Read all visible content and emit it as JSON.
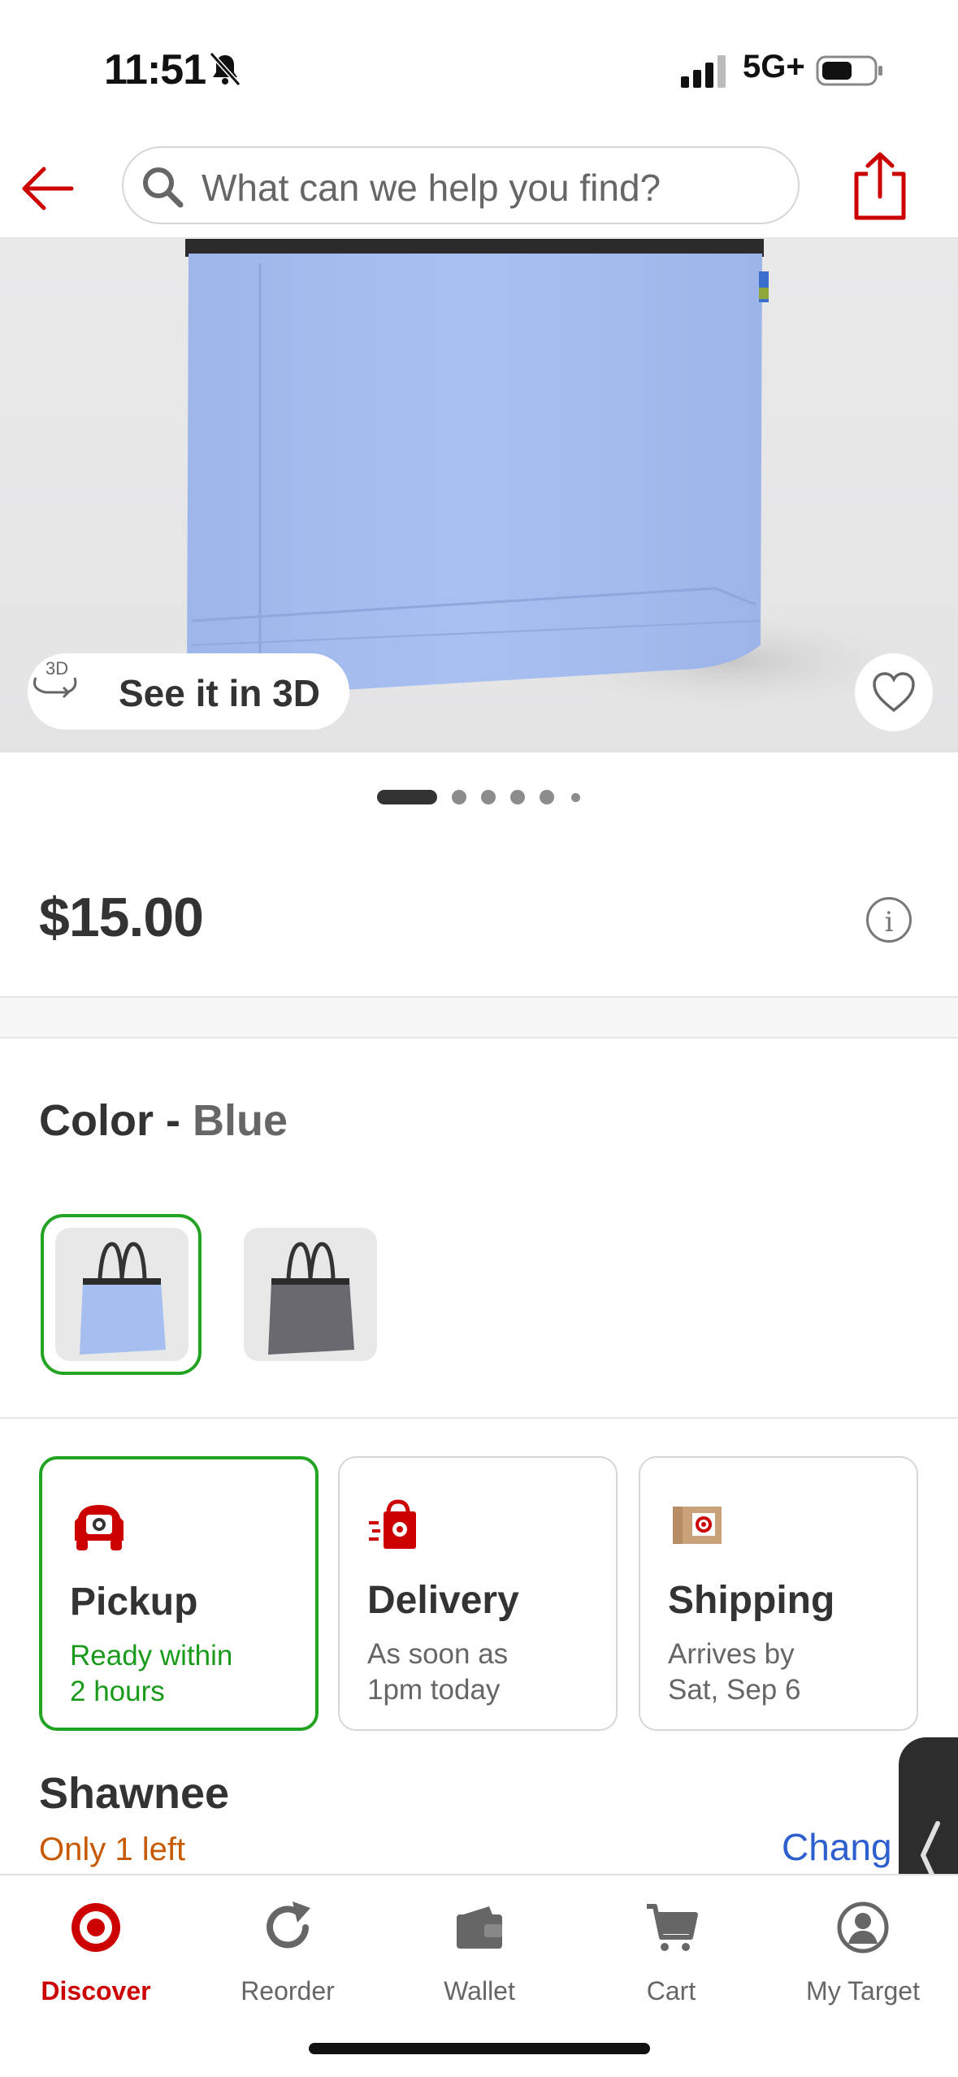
{
  "status_bar": {
    "time": "11:51",
    "network": "5G+",
    "icons": [
      "bell-slash-icon",
      "signal-icon",
      "battery-icon"
    ]
  },
  "header": {
    "search_placeholder": "What can we help you find?",
    "icons": [
      "back-arrow-icon",
      "search-icon",
      "share-icon"
    ]
  },
  "gallery": {
    "see_3d_label": "See it in 3D",
    "image_count": 6,
    "current_index": 1
  },
  "product": {
    "price": "$15.00"
  },
  "color": {
    "label": "Color",
    "separator": " - ",
    "value": "Blue",
    "options": [
      "Blue",
      "Gray"
    ],
    "selected": "Blue"
  },
  "fulfillment": {
    "options": [
      {
        "title": "Pickup",
        "line1": "Ready within",
        "line2": "2 hours",
        "selected": true
      },
      {
        "title": "Delivery",
        "line1": "As soon as",
        "line2": "1pm today",
        "selected": false
      },
      {
        "title": "Shipping",
        "line1": "Arrives by",
        "line2": "Sat, Sep 6",
        "selected": false
      }
    ]
  },
  "store": {
    "name": "Shawnee",
    "stock": "Only 1 left",
    "change_label": "Chang"
  },
  "bottom_nav": {
    "items": [
      {
        "label": "Discover",
        "icon": "target-bullseye-icon",
        "active": true
      },
      {
        "label": "Reorder",
        "icon": "refresh-icon",
        "active": false
      },
      {
        "label": "Wallet",
        "icon": "wallet-icon",
        "active": false
      },
      {
        "label": "Cart",
        "icon": "cart-icon",
        "active": false
      },
      {
        "label": "My Target",
        "icon": "user-circle-icon",
        "active": false
      }
    ]
  },
  "colors": {
    "brand_red": "#cc0000",
    "selected_green": "#22a322",
    "stock_orange": "#c75a00",
    "link_blue": "#2d5fce",
    "bag_blue": "#a6bff0"
  }
}
